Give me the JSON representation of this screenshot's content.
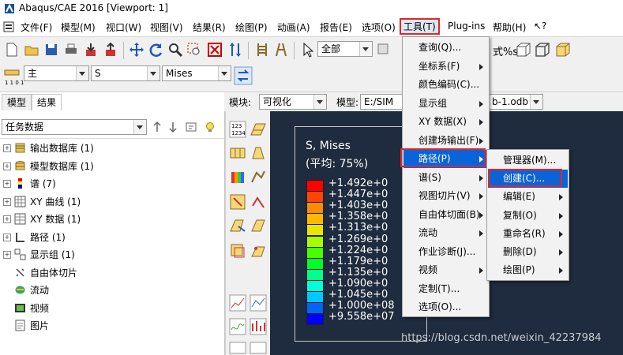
{
  "window": {
    "title": "Abaqus/CAE 2016 [Viewport: 1]"
  },
  "menubar": {
    "items": [
      "文件(F)",
      "模型(M)",
      "视口(W)",
      "视图(V)",
      "结果(R)",
      "绘图(P)",
      "动画(A)",
      "报告(E)",
      "选项(O)",
      "工具(T)",
      "Plug-ins",
      "帮助(H)",
      "↖?"
    ],
    "selected": "工具(T)"
  },
  "toolbar1": {
    "render_combo": "全部",
    "right_label": "式%s"
  },
  "toolbar2": {
    "step_combo": "主",
    "variable_combo": "S",
    "component_combo": "Mises"
  },
  "left_panel": {
    "tabs": [
      "模型",
      "结果"
    ],
    "active_tab": "结果",
    "filter_combo": "任务数据",
    "tree": [
      {
        "label": "输出数据库 (1)",
        "expand": "+",
        "icon": "database-icon"
      },
      {
        "label": "模型数据库 (1)",
        "expand": "+",
        "icon": "model-db-icon"
      },
      {
        "label": "谱 (7)",
        "expand": "+",
        "icon": "spectrum-icon"
      },
      {
        "label": "XY 曲线 (1)",
        "expand": "+",
        "icon": "xy-curve-icon"
      },
      {
        "label": "XY 数据 (1)",
        "expand": "+",
        "icon": "xy-data-icon"
      },
      {
        "label": "路径 (1)",
        "expand": "+",
        "icon": "path-icon"
      },
      {
        "label": "显示组 (1)",
        "expand": "+",
        "icon": "display-group-icon"
      },
      {
        "label": "自由体切片",
        "expand": "",
        "icon": "free-body-icon"
      },
      {
        "label": "流动",
        "expand": "",
        "icon": "flow-icon"
      },
      {
        "label": "视频",
        "expand": "",
        "icon": "video-icon"
      },
      {
        "label": "图片",
        "expand": "",
        "icon": "image-icon"
      }
    ]
  },
  "module_bar": {
    "module_label": "模块:",
    "module_value": "可视化",
    "model_label": "模型:",
    "model_value": "E:/SIM",
    "odb_value": "b-1.odb"
  },
  "legend": {
    "title": "S, Mises",
    "subtitle": "(平均: 75%)",
    "entries": [
      {
        "label": "+1.492e+0",
        "color": "#ff0000"
      },
      {
        "label": "+1.447e+0",
        "color": "#ff4600"
      },
      {
        "label": "+1.403e+0",
        "color": "#ff8c00"
      },
      {
        "label": "+1.358e+0",
        "color": "#ffb900"
      },
      {
        "label": "+1.313e+0",
        "color": "#e6e600"
      },
      {
        "label": "+1.269e+0",
        "color": "#a6ff00"
      },
      {
        "label": "+1.224e+0",
        "color": "#46ff00"
      },
      {
        "label": "+1.179e+0",
        "color": "#00ff28"
      },
      {
        "label": "+1.135e+0",
        "color": "#00ff8c"
      },
      {
        "label": "+1.090e+0",
        "color": "#00ffdc"
      },
      {
        "label": "+1.045e+0",
        "color": "#00c8ff"
      },
      {
        "label": "+1.000e+08",
        "color": "#0064ff"
      },
      {
        "label": "+9.558e+07",
        "color": "#0000ff"
      }
    ]
  },
  "watermark": "https://blog.csdn.net/weixin_42237984",
  "tools_menu": {
    "items": [
      {
        "label": "查询(Q)...",
        "sub": false
      },
      {
        "label": "坐标系(F)",
        "sub": true
      },
      {
        "label": "颜色编码(C)...",
        "sub": false
      },
      {
        "label": "显示组",
        "sub": true
      },
      {
        "label": "XY 数据(X)",
        "sub": true
      },
      {
        "label": "创建场输出(F)",
        "sub": true
      },
      {
        "label": "路径(P)",
        "sub": true
      },
      {
        "label": "谱(S)",
        "sub": true
      },
      {
        "label": "视图切片(V)",
        "sub": true
      },
      {
        "label": "自由体切面(B)",
        "sub": true
      },
      {
        "label": "流动",
        "sub": true
      },
      {
        "label": "作业诊断(J)...",
        "sub": false
      },
      {
        "label": "视频",
        "sub": true
      },
      {
        "label": "定制(T)...",
        "sub": false
      },
      {
        "label": "选项(O)...",
        "sub": false
      }
    ],
    "highlighted": "路径(P)"
  },
  "path_submenu": {
    "items": [
      {
        "label": "管理器(M)...",
        "sub": false
      },
      {
        "label": "创建(C)...",
        "sub": false
      },
      {
        "label": "编辑(E)",
        "sub": true
      },
      {
        "label": "复制(O)",
        "sub": true
      },
      {
        "label": "重命名(R)",
        "sub": true
      },
      {
        "label": "删除(D)",
        "sub": true
      },
      {
        "label": "绘图(P)",
        "sub": true
      }
    ],
    "highlighted": "创建(C)..."
  }
}
